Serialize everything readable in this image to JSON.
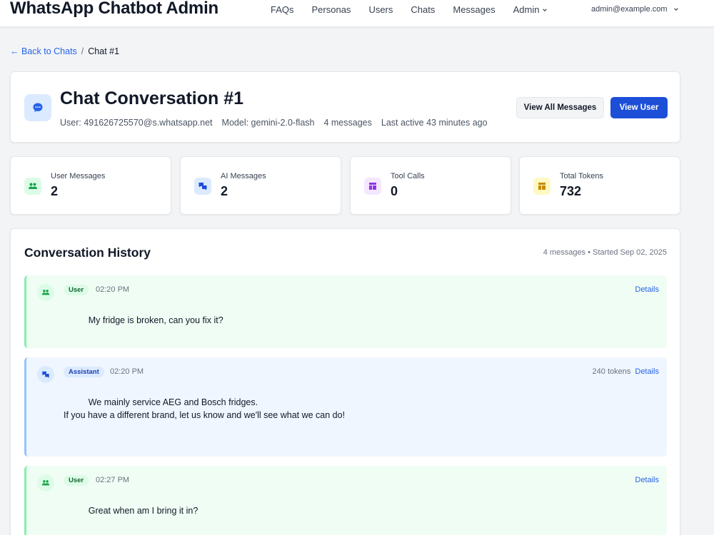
{
  "nav": {
    "brand": "WhatsApp Chatbot Admin",
    "links": [
      "FAQs",
      "Personas",
      "Users",
      "Chats",
      "Messages"
    ],
    "admin_label": "Admin",
    "user_email": "admin@example.com"
  },
  "breadcrumb": {
    "back_label": "← Back to Chats",
    "separator": "/",
    "current": "Chat #1"
  },
  "header": {
    "title": "Chat Conversation #1",
    "user": "User: 491626725570@s.whatsapp.net",
    "model": "Model: gemini-2.0-flash",
    "message_count": "4 messages",
    "last_active": "Last active 43 minutes ago",
    "view_all_label": "View All Messages",
    "view_user_label": "View User"
  },
  "stats": [
    {
      "label": "User Messages",
      "value": "2",
      "icon": "users-icon",
      "color": "#16a34a",
      "bg": "#dcfce7"
    },
    {
      "label": "AI Messages",
      "value": "2",
      "icon": "chat-bubbles-icon",
      "color": "#1d4ed8",
      "bg": "#dbeafe"
    },
    {
      "label": "Tool Calls",
      "value": "0",
      "icon": "layout-icon",
      "color": "#9333ea",
      "bg": "#f3e8ff"
    },
    {
      "label": "Total Tokens",
      "value": "732",
      "icon": "layout-icon",
      "color": "#ca8a04",
      "bg": "#fef9c3"
    }
  ],
  "history": {
    "title": "Conversation History",
    "meta": "4 messages • Started Sep 02, 2025",
    "messages": [
      {
        "role": "User",
        "time": "02:20 PM",
        "tokens": "",
        "details_label": "Details",
        "text": "          My fridge is broken, can you fix it?"
      },
      {
        "role": "Assistant",
        "time": "02:20 PM",
        "tokens": "240 tokens",
        "details_label": "Details",
        "text": "          We mainly service AEG and Bosch fridges.\nIf you have a different brand, let us know and we'll see what we can do!"
      },
      {
        "role": "User",
        "time": "02:27 PM",
        "tokens": "",
        "details_label": "Details",
        "text": "          Great when am I bring it in?"
      }
    ]
  },
  "colors": {
    "primary": "#1d4ed8",
    "link": "#2563eb",
    "user_bg": "#f0fdf4",
    "assistant_bg": "#eff6ff"
  }
}
